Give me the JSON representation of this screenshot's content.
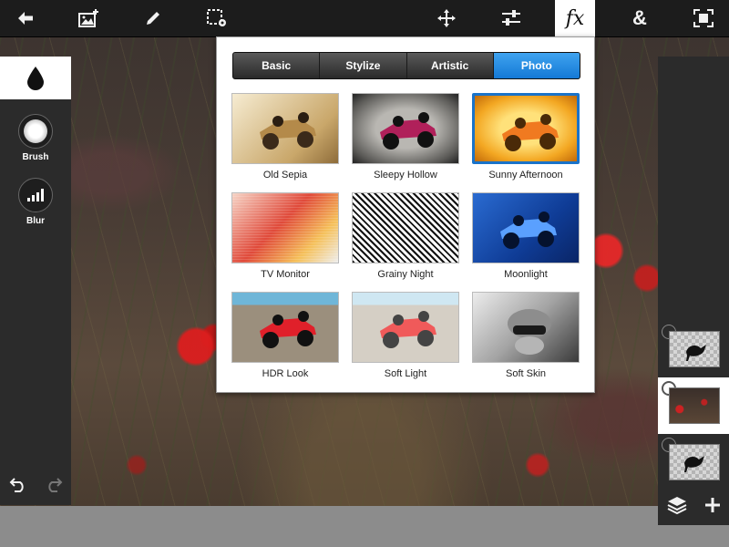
{
  "toolbar": {
    "icons": [
      "back-arrow-icon",
      "add-image-icon",
      "pencil-icon",
      "selection-settings-icon",
      "move-icon",
      "sliders-icon",
      "fx-icon",
      "ampersand-icon",
      "fullscreen-icon"
    ],
    "fx_glyph": "fx",
    "amp_glyph": "&"
  },
  "left_tools": {
    "brush_label": "Brush",
    "blur_label": "Blur"
  },
  "fx_panel": {
    "tabs": [
      {
        "label": "Basic",
        "active": false
      },
      {
        "label": "Stylize",
        "active": false
      },
      {
        "label": "Artistic",
        "active": false
      },
      {
        "label": "Photo",
        "active": true
      }
    ],
    "filters": [
      {
        "label": "Old Sepia",
        "style": "sepia"
      },
      {
        "label": "Sleepy Hollow",
        "style": "sleepy"
      },
      {
        "label": "Sunny Afternoon",
        "style": "sunny",
        "selected": true
      },
      {
        "label": "TV Monitor",
        "style": "tv"
      },
      {
        "label": "Grainy Night",
        "style": "grainy"
      },
      {
        "label": "Moonlight",
        "style": "moon"
      },
      {
        "label": "HDR Look",
        "style": "hdr"
      },
      {
        "label": "Soft Light",
        "style": "soft"
      },
      {
        "label": "Soft Skin",
        "style": "skin"
      }
    ]
  },
  "colors": {
    "accent": "#1a73c9",
    "toolbar_bg": "#1c1c1c",
    "panel_bg": "#2b2b2b"
  }
}
